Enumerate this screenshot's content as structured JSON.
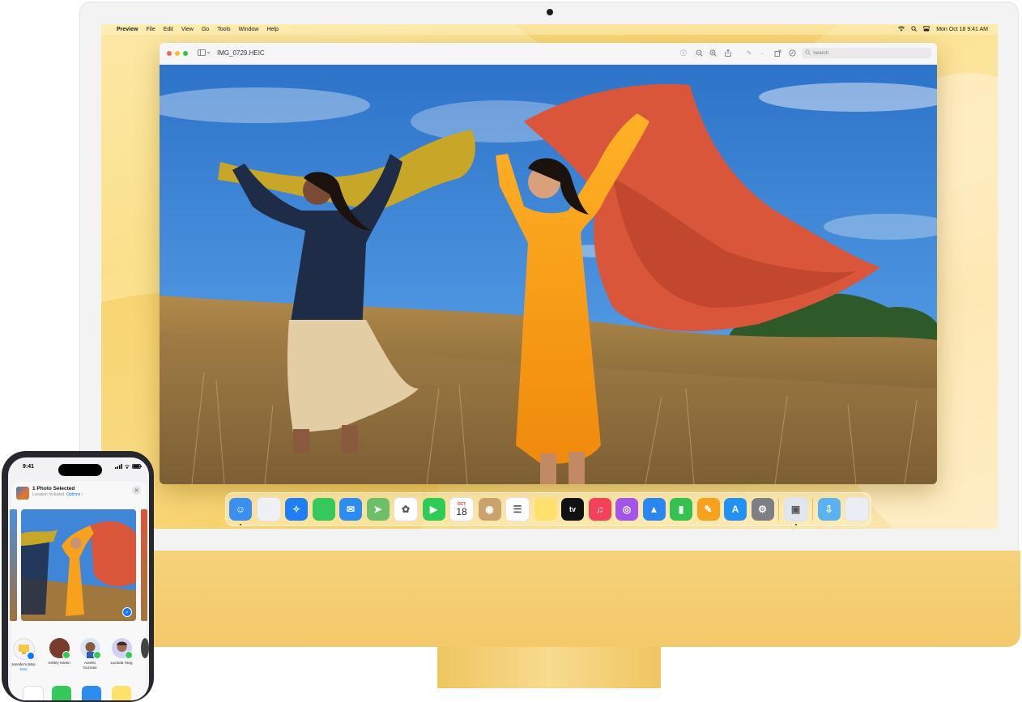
{
  "menubar": {
    "apple": "",
    "app": "Preview",
    "items": [
      "File",
      "Edit",
      "View",
      "Go",
      "Tools",
      "Window",
      "Help"
    ],
    "clock": "Mon Oct 18  9:41 AM"
  },
  "window": {
    "title": "IMG_0729.HEIC",
    "search_placeholder": "Search"
  },
  "dock": {
    "apps": [
      {
        "name": "finder",
        "icon": "finder-icon",
        "color": "#3a8ff0",
        "glyph": "☺",
        "running": true
      },
      {
        "name": "launchpad",
        "icon": "launchpad-icon",
        "color": "#eef0f4",
        "glyph": ""
      },
      {
        "name": "safari",
        "icon": "safari-icon",
        "color": "#1f7ff2",
        "glyph": "✧"
      },
      {
        "name": "messages",
        "icon": "messages-icon",
        "color": "#35c95b",
        "glyph": ""
      },
      {
        "name": "mail",
        "icon": "mail-icon",
        "color": "#2d8cf0",
        "glyph": "✉"
      },
      {
        "name": "maps",
        "icon": "maps-icon",
        "color": "#6cc06a",
        "glyph": "➤"
      },
      {
        "name": "photos",
        "icon": "photos-icon",
        "color": "#ffffff",
        "glyph": "✿"
      },
      {
        "name": "facetime",
        "icon": "facetime-icon",
        "color": "#2fcb57",
        "glyph": "▶"
      },
      {
        "name": "calendar",
        "icon": "calendar-icon",
        "color": "#ffffff",
        "glyph": "18",
        "month": "OCT"
      },
      {
        "name": "contacts",
        "icon": "contacts-icon",
        "color": "#c9a36b",
        "glyph": "◉"
      },
      {
        "name": "reminders",
        "icon": "reminders-icon",
        "color": "#ffffff",
        "glyph": "☰"
      },
      {
        "name": "notes",
        "icon": "notes-icon",
        "color": "#fde16c",
        "glyph": ""
      },
      {
        "name": "tv",
        "icon": "apple-tv-icon",
        "color": "#111111",
        "glyph": "tv"
      },
      {
        "name": "music",
        "icon": "music-icon",
        "color": "#f5405a",
        "glyph": "♫"
      },
      {
        "name": "podcasts",
        "icon": "podcasts-icon",
        "color": "#a255e8",
        "glyph": "◎"
      },
      {
        "name": "keynote",
        "icon": "keynote-icon",
        "color": "#2a86f0",
        "glyph": "▲"
      },
      {
        "name": "numbers",
        "icon": "numbers-icon",
        "color": "#33c250",
        "glyph": "▮"
      },
      {
        "name": "pages",
        "icon": "pages-icon",
        "color": "#f7a11d",
        "glyph": "✎"
      },
      {
        "name": "app store",
        "icon": "app-store-icon",
        "color": "#2390f4",
        "glyph": "A"
      },
      {
        "name": "system preferences",
        "icon": "system-preferences-icon",
        "color": "#7d7f84",
        "glyph": "⚙"
      }
    ],
    "recents": [
      {
        "name": "preview",
        "icon": "preview-icon",
        "color": "#dfe6ee",
        "glyph": "▣",
        "running": true
      }
    ],
    "stack": [
      {
        "name": "downloads",
        "icon": "downloads-folder-icon",
        "color": "#5ab2f0",
        "glyph": "⇩"
      },
      {
        "name": "trash",
        "icon": "trash-icon",
        "color": "#eaeef2",
        "glyph": ""
      }
    ]
  },
  "phone": {
    "time": "9:41",
    "share": {
      "title": "1 Photo Selected",
      "subtitle": "Location Included",
      "options": "Options ›"
    },
    "people": [
      {
        "name": "Jennifer's iMac",
        "sub": "Sent",
        "color": "#f4f4f6"
      },
      {
        "name": "Ashley Kamin",
        "sub": "",
        "color": "#7a3b2f"
      },
      {
        "name": "Aurelio Guzman",
        "sub": "",
        "color": "#d9e6f7"
      },
      {
        "name": "Lucinda Yang",
        "sub": "",
        "color": "#cfd2f6"
      }
    ]
  }
}
